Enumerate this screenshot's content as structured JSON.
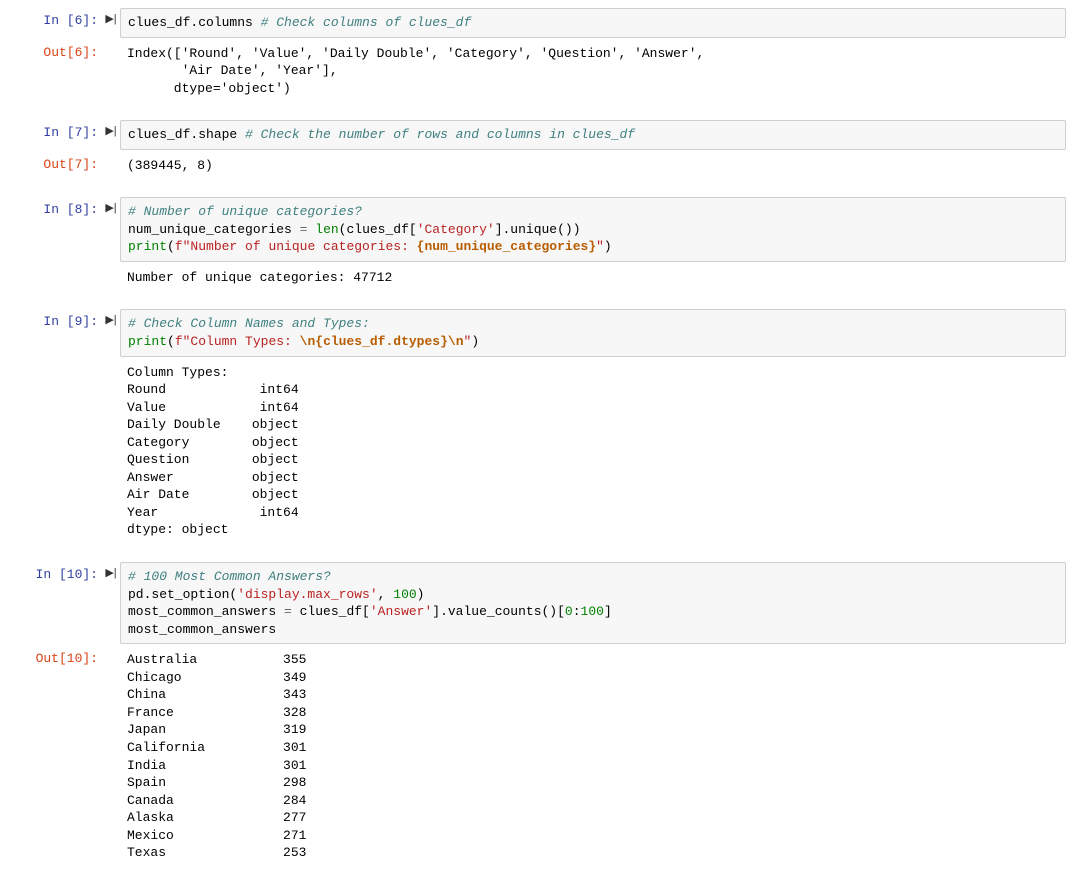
{
  "cells": {
    "c6": {
      "in_prompt": "In [6]:",
      "out_prompt": "Out[6]:",
      "code": {
        "expr": "clues_df.columns ",
        "comment": "# Check columns of clues_df"
      },
      "output": "Index(['Round', 'Value', 'Daily Double', 'Category', 'Question', 'Answer',\n       'Air Date', 'Year'],\n      dtype='object')"
    },
    "c7": {
      "in_prompt": "In [7]:",
      "out_prompt": "Out[7]:",
      "code": {
        "expr": "clues_df.shape ",
        "comment": "# Check the number of rows and columns in clues_df"
      },
      "output": "(389445, 8)"
    },
    "c8": {
      "in_prompt": "In [8]:",
      "code": {
        "comment1": "# Number of unique categories?",
        "line2_a": "num_unique_categories ",
        "line2_op": "=",
        "line2_b": " ",
        "line2_len": "len",
        "line2_c": "(clues_df[",
        "line2_str": "'Category'",
        "line2_d": "].unique())",
        "line3_print": "print",
        "line3_a": "(",
        "line3_f": "f\"Number of unique categories: ",
        "line3_interp": "{num_unique_categories}",
        "line3_end": "\"",
        "line3_b": ")"
      },
      "output": "Number of unique categories: 47712"
    },
    "c9": {
      "in_prompt": "In [9]:",
      "code": {
        "comment1": "# Check Column Names and Types:",
        "line2_print": "print",
        "line2_a": "(",
        "line2_s1": "f\"Column Types: ",
        "line2_esc1": "\\n",
        "line2_interp": "{clues_df.dtypes}",
        "line2_esc2": "\\n",
        "line2_s2": "\"",
        "line2_b": ")"
      },
      "output": "Column Types: \nRound            int64\nValue            int64\nDaily Double    object\nCategory        object\nQuestion        object\nAnswer          object\nAir Date        object\nYear             int64\ndtype: object\n"
    },
    "c10": {
      "in_prompt": "In [10]:",
      "out_prompt": "Out[10]:",
      "code": {
        "comment1": "# 100 Most Common Answers?",
        "line2_a": "pd.set_option(",
        "line2_s": "'display.max_rows'",
        "line2_b": ", ",
        "line2_n": "100",
        "line2_c": ")",
        "line3_a": "most_common_answers ",
        "line3_op": "=",
        "line3_b": " clues_df[",
        "line3_s": "'Answer'",
        "line3_c": "].value_counts()[",
        "line3_n0": "0",
        "line3_colon": ":",
        "line3_n1": "100",
        "line3_d": "]",
        "line4": "most_common_answers"
      },
      "output": "Australia           355\nChicago             349\nChina               343\nFrance              328\nJapan               319\nCalifornia          301\nIndia               301\nSpain               298\nCanada              284\nAlaska              277\nMexico              271\nTexas               253"
    }
  }
}
